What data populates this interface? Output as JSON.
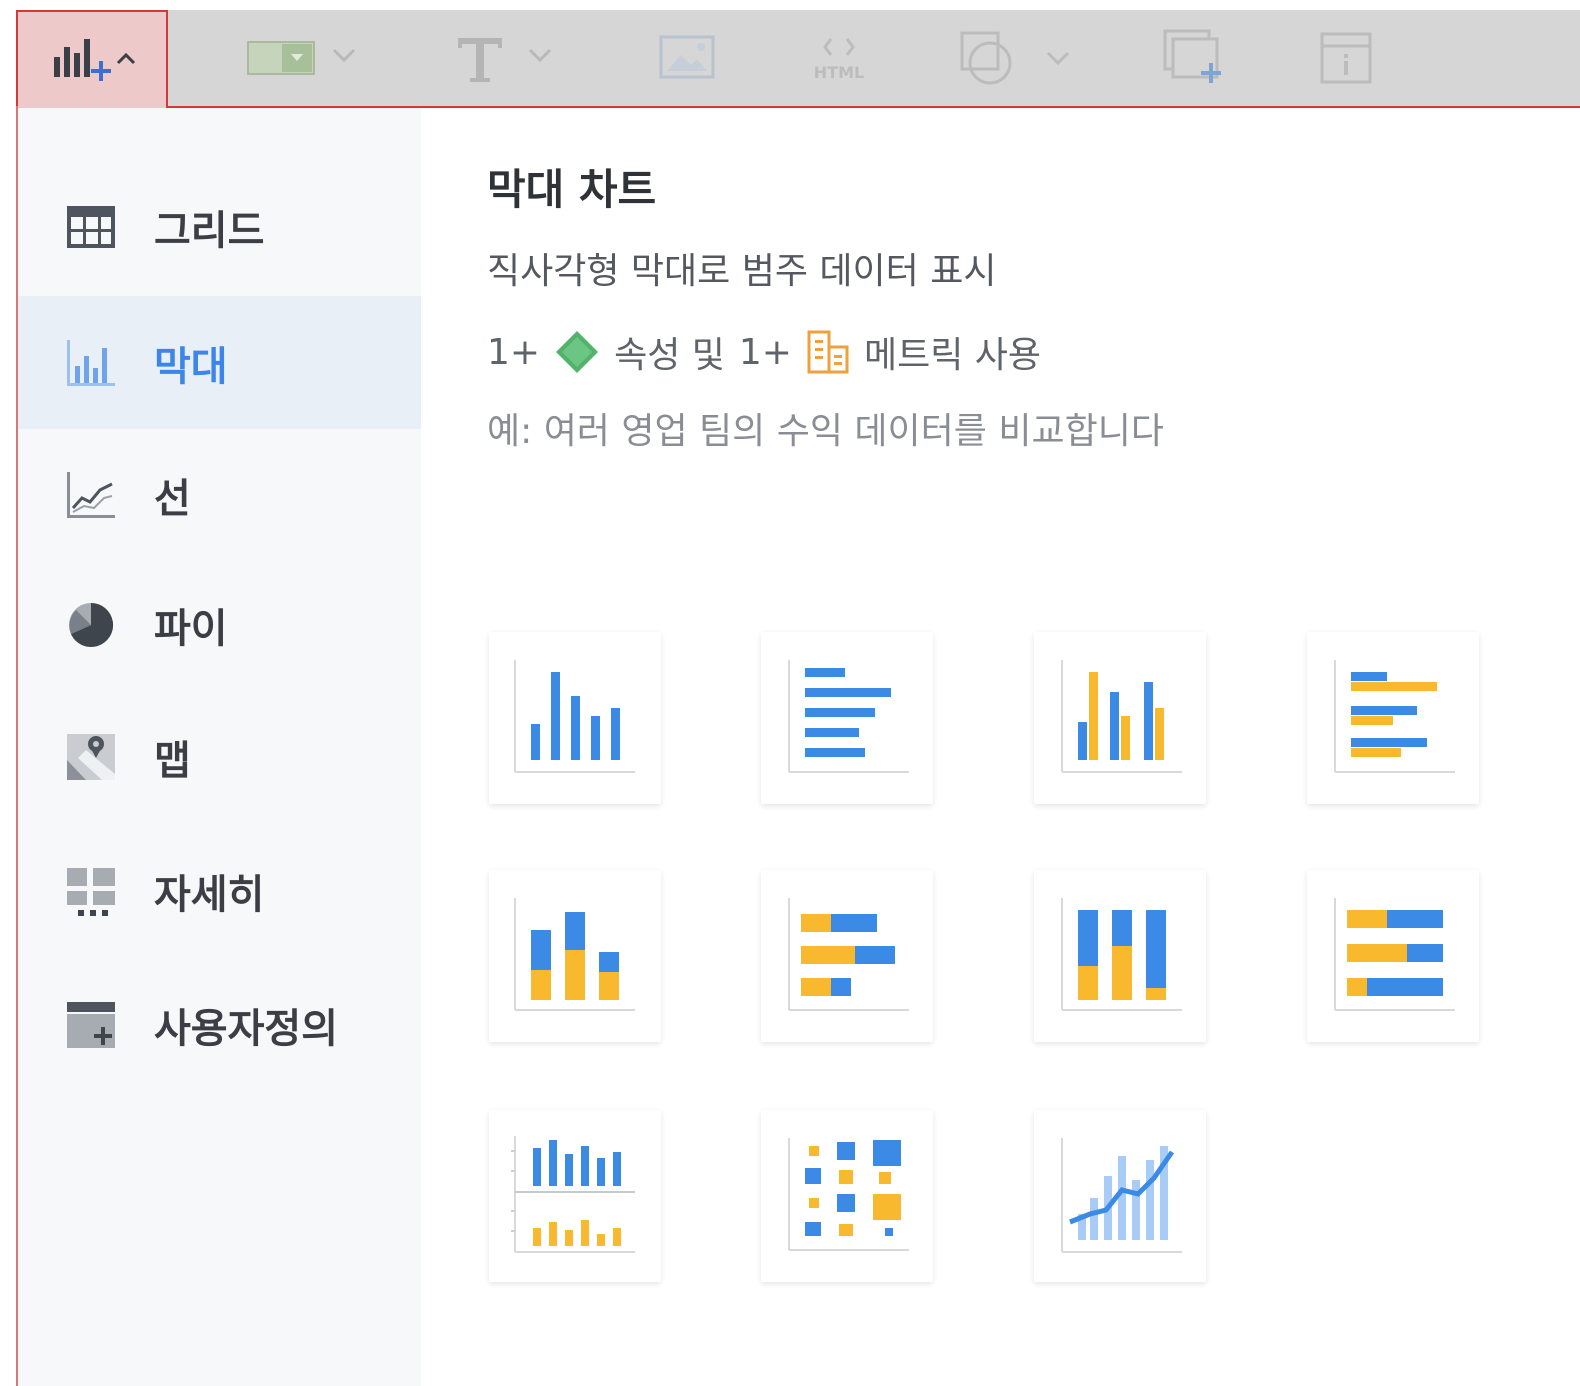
{
  "toolbar": {
    "items": [
      {
        "name": "add-chart",
        "icon": "bar-chart-plus-icon",
        "active": true
      },
      {
        "name": "filter-control",
        "icon": "filter-control-icon"
      },
      {
        "name": "text",
        "icon": "text-icon"
      },
      {
        "name": "image",
        "icon": "image-icon"
      },
      {
        "name": "html",
        "icon": "html-icon",
        "label": "HTML"
      },
      {
        "name": "shapes",
        "icon": "shapes-icon"
      },
      {
        "name": "add-panel",
        "icon": "add-panel-icon"
      },
      {
        "name": "info",
        "icon": "info-icon"
      }
    ]
  },
  "sidebar": {
    "items": [
      {
        "label": "그리드",
        "icon": "grid-icon"
      },
      {
        "label": "막대",
        "icon": "bar-chart-icon",
        "active": true
      },
      {
        "label": "선",
        "icon": "line-chart-icon"
      },
      {
        "label": "파이",
        "icon": "pie-chart-icon"
      },
      {
        "label": "맵",
        "icon": "map-icon"
      },
      {
        "label": "자세히",
        "icon": "more-icon"
      },
      {
        "label": "사용자정의",
        "icon": "custom-chart-icon"
      }
    ]
  },
  "detail": {
    "title": "막대 차트",
    "description": "직사각형 막대로 범주 데이터 표시",
    "requirement": {
      "attr_count": "1+",
      "attr_text": "속성 및",
      "metric_count": "1+",
      "metric_text": "메트릭 사용"
    },
    "example": "예: 여러 영업 팀의 수익 데이터를 비교합니다"
  },
  "chart_types": [
    {
      "icon": "vertical-bar-icon"
    },
    {
      "icon": "horizontal-bar-icon"
    },
    {
      "icon": "vertical-clustered-bar-icon"
    },
    {
      "icon": "horizontal-clustered-bar-icon"
    },
    {
      "icon": "vertical-stacked-bar-icon"
    },
    {
      "icon": "horizontal-stacked-bar-icon"
    },
    {
      "icon": "vertical-percent-stacked-bar-icon"
    },
    {
      "icon": "horizontal-percent-stacked-bar-icon"
    },
    {
      "icon": "multi-axis-bar-icon"
    },
    {
      "icon": "bubble-grid-icon"
    },
    {
      "icon": "bar-line-combo-icon"
    }
  ],
  "colors": {
    "blue": "#3b8ae6",
    "yellow": "#f9b92f",
    "accent_red": "#d23a3a",
    "attribute_green": "#4caf62",
    "metric_orange": "#f0a03a"
  }
}
